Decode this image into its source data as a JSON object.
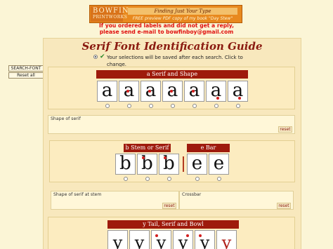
{
  "banner": {
    "logo_line1": "BOWFIN",
    "logo_line2": "PRINTWORKS",
    "title": "Finding Just Your Type",
    "subtitle": "FREE preview PDF copy of my book \"Day Stew\""
  },
  "notice": {
    "line1": "If you ordered labels and did not get a reply,",
    "line2": "please send e-mail to bowfinboy@gmail.com"
  },
  "page_title": "Serif Font Identification Guide",
  "save_note": "Your selections will be saved after each search. Click to change.",
  "sidebar": {
    "search_label": "SEARCH-FONT",
    "reset_all_label": "Reset all"
  },
  "sections": {
    "a_serif": {
      "header": "a Serif and Shape",
      "glyphs": [
        "a",
        "a",
        "a",
        "a",
        "a",
        "a",
        "a"
      ],
      "field_label": "Shape of serif",
      "reset_label": "reset"
    },
    "b_stem": {
      "header": "b Stem or Serif",
      "glyphs": [
        "b",
        "b",
        "b"
      ],
      "field_label": "Shape of serif at stem",
      "reset_label": "reset"
    },
    "e_bar": {
      "header": "e Bar",
      "glyphs": [
        "e",
        "e"
      ],
      "field_label": "Crossbar",
      "reset_label": "reset"
    },
    "y_tail": {
      "header": "y Tail, Serif and Bowl",
      "glyphs": [
        "y",
        "y",
        "y",
        "y",
        "y",
        "y"
      ]
    }
  },
  "colors": {
    "header_bg": "#9e1a0c",
    "notice": "#e0100e",
    "title": "#8a1a10",
    "page_bg": "#fbf5d6"
  }
}
